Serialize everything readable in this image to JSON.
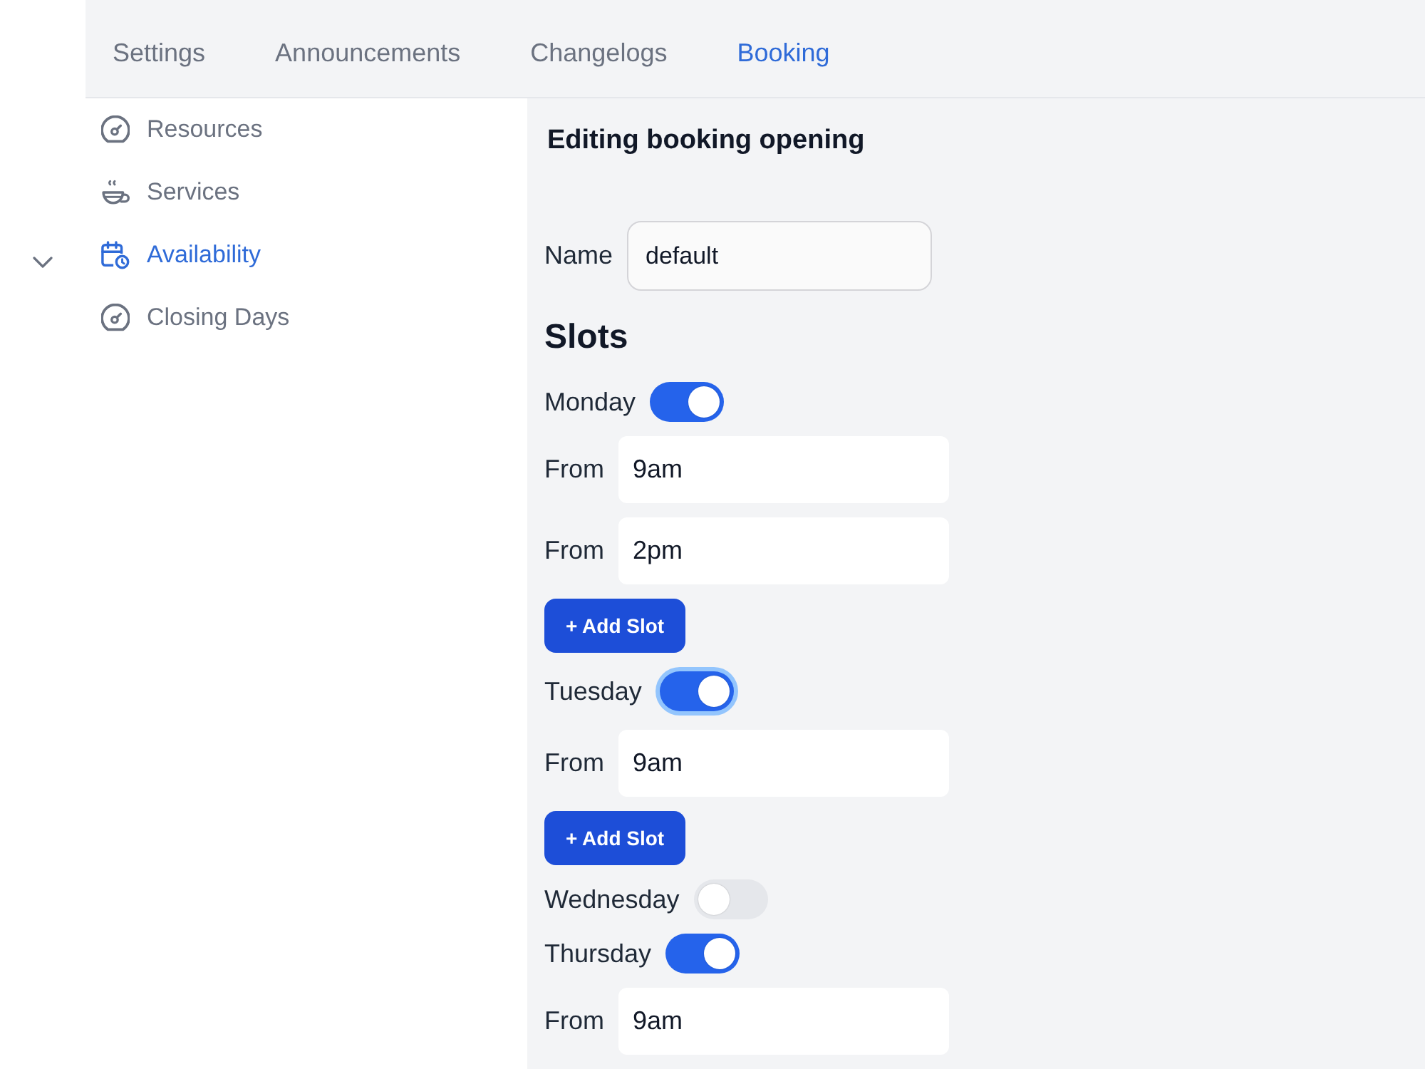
{
  "tabs": [
    {
      "label": "Settings",
      "selected": false
    },
    {
      "label": "Announcements",
      "selected": false
    },
    {
      "label": "Changelogs",
      "selected": false
    },
    {
      "label": "Booking",
      "selected": true
    }
  ],
  "sidebar": {
    "items": [
      {
        "label": "Resources",
        "kind": "dial",
        "selected": false
      },
      {
        "label": "Services",
        "kind": "cup",
        "selected": false
      },
      {
        "label": "Availability",
        "kind": "calendar",
        "selected": true
      },
      {
        "label": "Closing Days",
        "kind": "dial",
        "selected": false
      }
    ]
  },
  "editor": {
    "title": "Editing booking opening",
    "name_label": "Name",
    "name_value": "default",
    "slots_heading": "Slots",
    "days": [
      {
        "label": "Monday",
        "on": true,
        "focused": false,
        "slots": [
          {
            "label": "From",
            "value": "9am"
          },
          {
            "label": "From",
            "value": "2pm"
          }
        ],
        "add_button": "+ Add Slot"
      },
      {
        "label": "Tuesday",
        "on": true,
        "focused": true,
        "slots": [
          {
            "label": "From",
            "value": "9am"
          }
        ],
        "add_button": "+ Add Slot"
      },
      {
        "label": "Wednesday",
        "on": false,
        "focused": false
      },
      {
        "label": "Thursday",
        "on": true,
        "focused": false,
        "slots": [
          {
            "label": "From",
            "value": "9am"
          }
        ]
      }
    ]
  }
}
